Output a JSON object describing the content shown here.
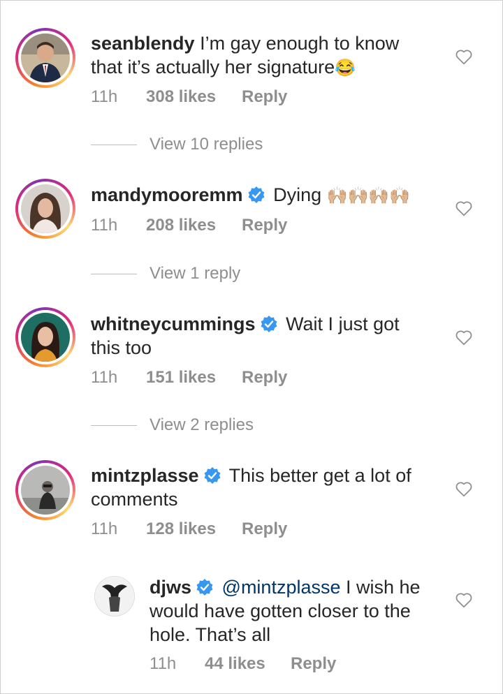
{
  "comments": [
    {
      "username": "seanblendy",
      "verified": false,
      "text": "I’m gay enough to know that it’s actually her signature",
      "emoji": "😂",
      "time": "11h",
      "likes": "308 likes",
      "reply": "Reply",
      "view_replies": "View 10 replies"
    },
    {
      "username": "mandymooremm",
      "verified": true,
      "text": "Dying",
      "emoji": "🙌🏼🙌🏼🙌🏼🙌🏼",
      "time": "11h",
      "likes": "208 likes",
      "reply": "Reply",
      "view_replies": "View 1 reply"
    },
    {
      "username": "whitneycummings",
      "verified": true,
      "text": "Wait I just got this too",
      "time": "11h",
      "likes": "151 likes",
      "reply": "Reply",
      "view_replies": "View 2 replies"
    },
    {
      "username": "mintzplasse",
      "verified": true,
      "text": "This better get a lot of comments",
      "time": "11h",
      "likes": "128 likes",
      "reply": "Reply"
    }
  ],
  "reply": {
    "username": "djws",
    "verified": true,
    "mention": "@mintzplasse",
    "text": "I wish he would have gotten closer to the hole. That’s all",
    "time": "11h",
    "likes": "44 likes",
    "reply": "Reply"
  },
  "icons": {
    "like": "heart-outline-icon",
    "verified": "verified-badge-icon"
  },
  "colors": {
    "text": "#262626",
    "meta": "#8e8e8e",
    "verified": "#3897f0",
    "mention": "#003569"
  }
}
